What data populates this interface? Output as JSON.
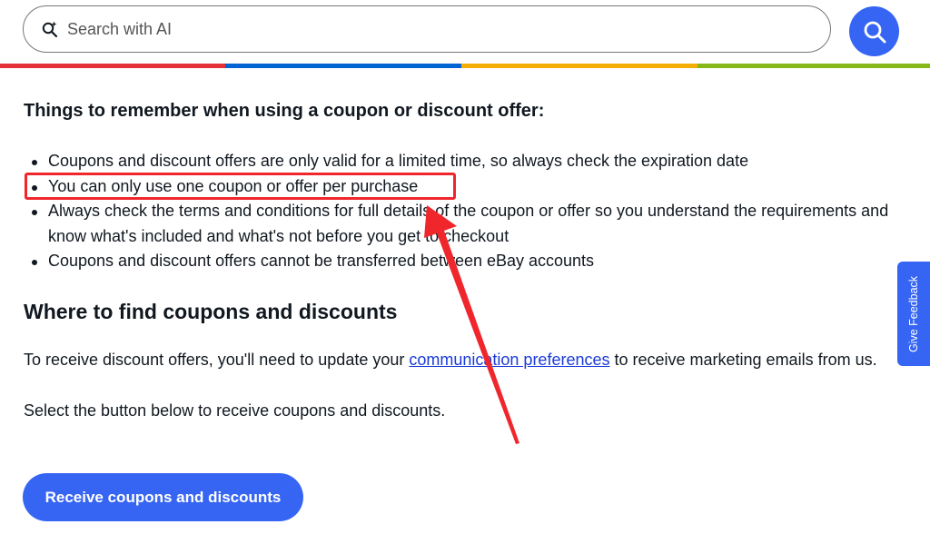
{
  "search": {
    "placeholder": "Search with AI",
    "icon": "ai-sparkle-search-icon",
    "button_icon": "search-icon"
  },
  "stripe_colors": [
    "#e53238",
    "#0064d2",
    "#f5af02",
    "#86b817"
  ],
  "section1": {
    "heading": "Things to remember when using a coupon or discount offer:",
    "bullets": [
      "Coupons and discount offers are only valid for a limited time, so always check the expiration date",
      "You can only use one coupon or offer per purchase",
      "Always check the terms and conditions for full details of the coupon or offer so you understand the requirements and know what's included and what's not before you get to checkout",
      "Coupons and discount offers cannot be transferred between eBay accounts"
    ]
  },
  "section2": {
    "heading": "Where to find coupons and discounts",
    "receive_text_before": "To receive discount offers, you'll need to update your ",
    "receive_link": "communication preferences",
    "receive_text_after": " to receive marketing emails from us.",
    "select_text": "Select the button below to receive coupons and discounts.",
    "cta_label": "Receive coupons and discounts"
  },
  "feedback_tab": {
    "label": "Give Feedback"
  },
  "colors": {
    "primary_blue": "#3665f3",
    "link": "#1a3ad8",
    "annotation_red": "#f0262d",
    "text": "#111820"
  }
}
